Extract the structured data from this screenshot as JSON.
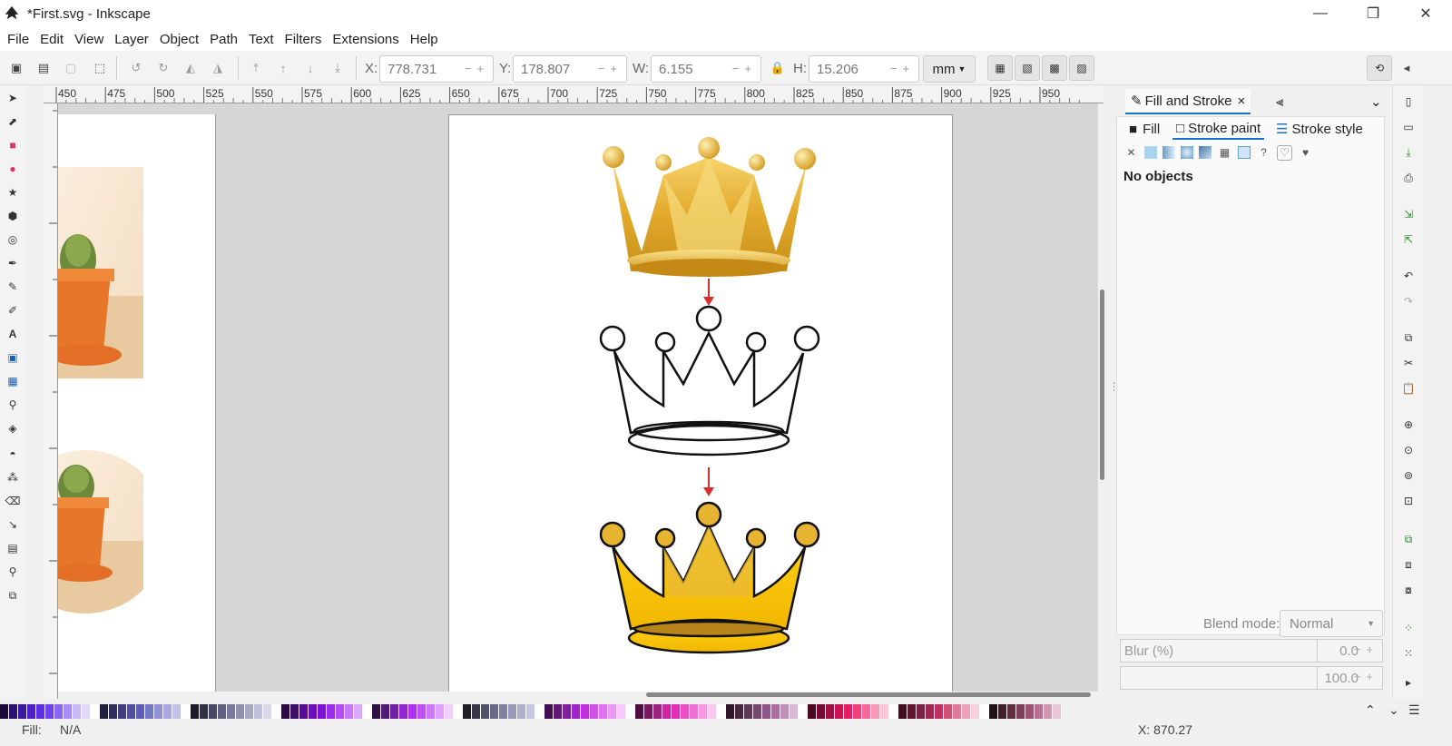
{
  "window": {
    "title": "*First.svg - Inkscape",
    "minimize": "—",
    "maximize": "❐",
    "close": "✕"
  },
  "menu": [
    "File",
    "Edit",
    "View",
    "Layer",
    "Object",
    "Path",
    "Text",
    "Filters",
    "Extensions",
    "Help"
  ],
  "toolbar": {
    "x_label": "X:",
    "x_value": "778.731",
    "y_label": "Y:",
    "y_value": "178.807",
    "w_label": "W:",
    "w_value": "6.155",
    "h_label": "H:",
    "h_value": "15.206",
    "unit": "mm"
  },
  "ruler": {
    "h_ticks": [
      "450",
      "475",
      "500",
      "525",
      "550",
      "575",
      "600",
      "625",
      "650",
      "675",
      "700",
      "725",
      "750",
      "775",
      "800",
      "825",
      "850",
      "875",
      "900",
      "925",
      "950"
    ]
  },
  "panel": {
    "tab_title": "Fill and Stroke",
    "tab_close": "×",
    "sub_fill": "Fill",
    "sub_stroke_paint": "Stroke paint",
    "sub_stroke_style": "Stroke style",
    "no_objects": "No objects",
    "blend_label": "Blend mode:",
    "blend_value": "Normal",
    "blur_label": "Blur (%)",
    "blur_value": "0.0",
    "opacity_value": "100.0"
  },
  "status": {
    "fill_label": "Fill:",
    "fill_value": "N/A",
    "coords": "X: 870.27"
  },
  "colors": {
    "accent": "#1a73c8",
    "crown_gold": "#e8b52a",
    "crown_flat": "#ffc800",
    "arrow_red": "#d63030"
  },
  "palette": [
    "#1a0a3a",
    "#2a1170",
    "#3a18a0",
    "#4b22c8",
    "#5c30e0",
    "#6e44ee",
    "#8a66f2",
    "#a88ef5",
    "#c8b8f8",
    "#e2d9fb",
    "#fff",
    "#202040",
    "#30305a",
    "#404080",
    "#5050a0",
    "#6060b8",
    "#7878c8",
    "#9090d4",
    "#a8a8e0",
    "#c0c0ea",
    "#fff",
    "#1a1a2a",
    "#303046",
    "#484866",
    "#606080",
    "#78789a",
    "#9090b0",
    "#a8a8c4",
    "#c0c0d8",
    "#d8d8ea",
    "#fff",
    "#2a0a40",
    "#3e0c68",
    "#540e90",
    "#6a10b8",
    "#8012d8",
    "#9a2ef0",
    "#b050f5",
    "#c878f8",
    "#dca8fa",
    "#fff",
    "#30104a",
    "#501a78",
    "#7020a8",
    "#9028d0",
    "#b030f0",
    "#c050f8",
    "#d078fa",
    "#e0a0fc",
    "#f0d0fe",
    "#fff",
    "#202028",
    "#383848",
    "#505068",
    "#686888",
    "#8080a0",
    "#9898b8",
    "#b0b0cc",
    "#c8c8de",
    "#fff",
    "#401050",
    "#601878",
    "#8020a0",
    "#a028c8",
    "#c030e0",
    "#d050ea",
    "#e070f0",
    "#ee98f5",
    "#f8c8fa",
    "#fff",
    "#501040",
    "#781860",
    "#a02080",
    "#c828a0",
    "#e030b8",
    "#ea50c8",
    "#f070d4",
    "#f598e0",
    "#fac8ee",
    "#fff",
    "#301828",
    "#482840",
    "#603858",
    "#784870",
    "#905888",
    "#a870a0",
    "#c090b8",
    "#d8b8d0",
    "#fff",
    "#500820",
    "#780c30",
    "#a01040",
    "#c81450",
    "#e81c60",
    "#f0407a",
    "#f56898",
    "#f898b8",
    "#fbc8d8",
    "#fff",
    "#401020",
    "#601830",
    "#802040",
    "#a02850",
    "#c03060",
    "#d05078",
    "#e07898",
    "#eea0b8",
    "#f8d0dc",
    "#fff",
    "#201018",
    "#402028",
    "#603040",
    "#804058",
    "#a05070",
    "#b87090",
    "#d098b0",
    "#e8c8d8"
  ]
}
